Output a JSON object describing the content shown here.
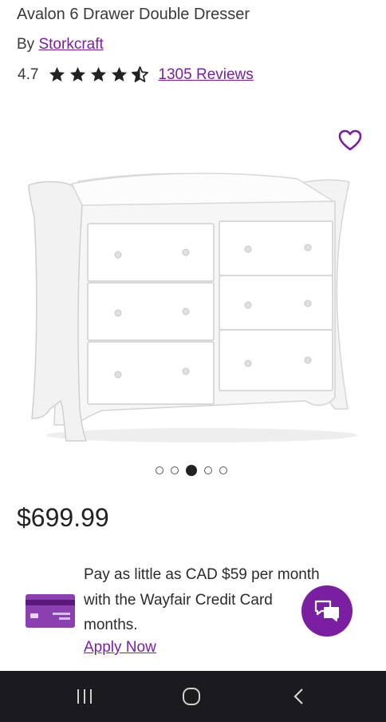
{
  "product": {
    "title": "Avalon 6 Drawer Double Dresser",
    "by_prefix": "By",
    "brand": "Storkcraft",
    "rating": "4.7",
    "stars_value": 4.5,
    "reviews_label": "1305 Reviews",
    "price": "$699.99"
  },
  "gallery": {
    "image_count": 5,
    "active_index": 2
  },
  "financing": {
    "line1": "Pay as little as CAD $59 per month",
    "line2": "with the Wayfair Credit Card",
    "line2_tail": "?",
    "line3": "months.",
    "apply_label": "Apply Now"
  },
  "colors": {
    "accent": "#7b1fa2",
    "navbar": "#1b1b1f"
  },
  "icons": {
    "favorite": "heart-icon",
    "chat": "chat-icon",
    "card": "credit-card-icon",
    "nav_recent": "recent-apps-icon",
    "nav_home": "home-icon",
    "nav_back": "back-icon"
  }
}
